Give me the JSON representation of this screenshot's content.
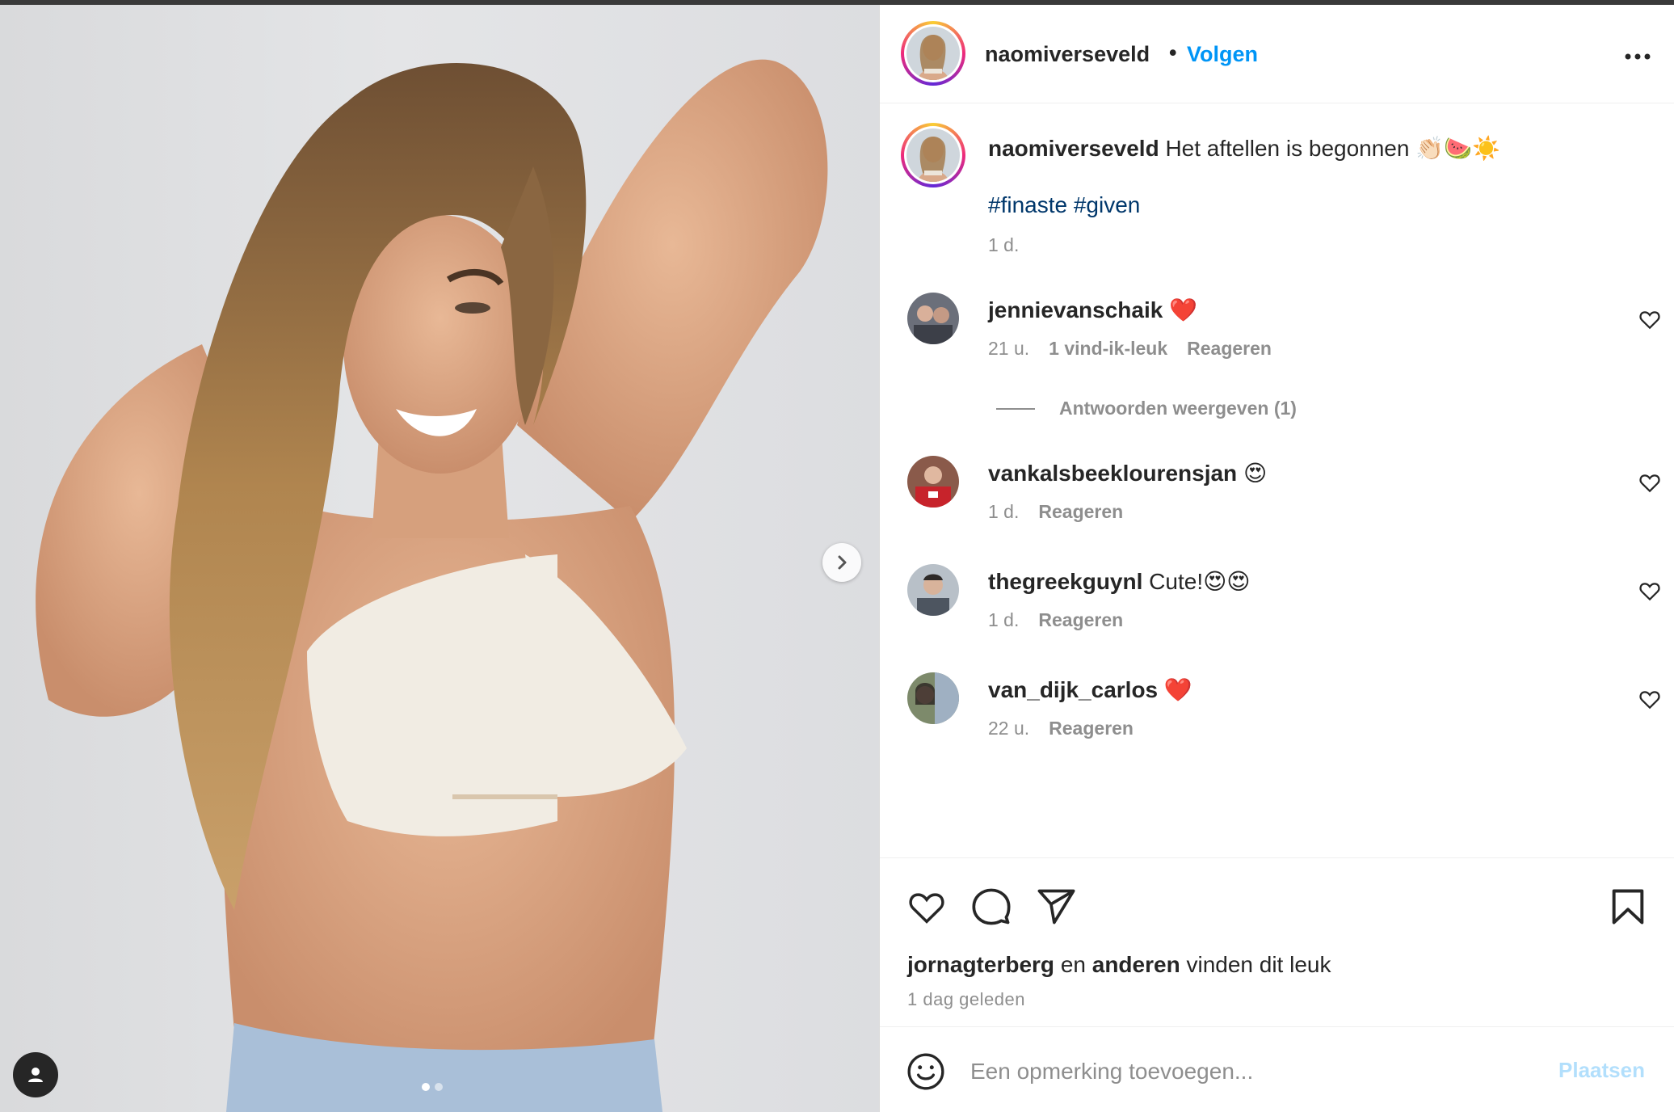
{
  "post": {
    "author": "naomiverseveld",
    "follow_label": "Volgen",
    "header_separator": "•",
    "caption_text": "Het aftellen is begonnen 👏🏻🍉☀️",
    "hashtags": "#finaste #given",
    "caption_time": "1 d."
  },
  "comments": [
    {
      "user": "jennievanschaik",
      "text": "❤️",
      "time": "21 u.",
      "likes": "1 vind-ik-leuk",
      "reply": "Reageren"
    },
    {
      "user": "vankalsbeeklourensjan",
      "text": "😍",
      "time": "1 d.",
      "likes": "",
      "reply": "Reageren"
    },
    {
      "user": "thegreekguynl",
      "text": "Cute!😍😍",
      "time": "1 d.",
      "likes": "",
      "reply": "Reageren"
    },
    {
      "user": "van_dijk_carlos",
      "text": "❤️",
      "time": "22 u.",
      "likes": "",
      "reply": "Reageren"
    }
  ],
  "replies_toggle": "Antwoorden weergeven (1)",
  "likes_bar": {
    "liker": "jornagterberg",
    "and": "en",
    "others": "anderen",
    "suffix": "vinden dit leuk",
    "posted": "1 dag geleden"
  },
  "add_comment": {
    "placeholder": "Een opmerking toevoegen...",
    "post_label": "Plaatsen"
  },
  "colors": {
    "link": "#0095f6",
    "hashtag": "#00376b",
    "muted": "#8e8e8e",
    "post_disabled": "#b2dffc"
  },
  "icons": [
    "more-options-icon",
    "heart-icon",
    "comment-icon",
    "share-icon",
    "bookmark-icon",
    "emoji-icon",
    "chevron-right-icon",
    "user-tag-icon"
  ]
}
